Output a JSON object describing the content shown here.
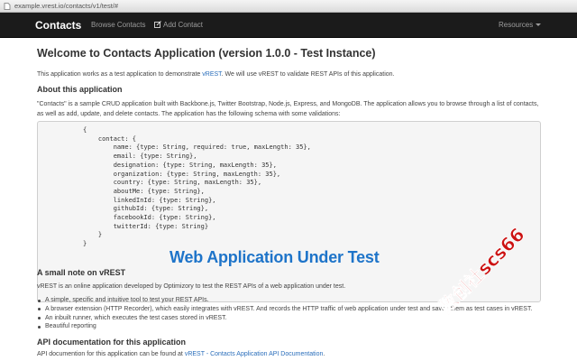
{
  "browser": {
    "url": "example.vrest.io/contacts/v1/test/#",
    "favicon_icon": "page-icon"
  },
  "navbar": {
    "brand": "Contacts",
    "browse": "Browse Contacts",
    "add": "Add Contact",
    "add_icon": "edit-plus-icon",
    "resources": "Resources"
  },
  "main": {
    "title": "Welcome to Contacts Application (version 1.0.0 - Test Instance)",
    "intro_before": "This application works as a test application to demonstrate ",
    "intro_link": "vREST",
    "intro_after": ". We will use vREST to validate REST APIs of this application.",
    "about_heading": "About this application",
    "about_text": "\"Contacts\" is a sample CRUD application built with Backbone.js, Twitter Bootstrap, Node.js, Express, and MongoDB. The application allows you to browse through a list of contacts, as well as add, update, and delete contacts. The application has the following schema with some validations:",
    "schema_code": "{\n    contact: {\n        name: {type: String, required: true, maxLength: 35},\n        email: {type: String},\n        designation: {type: String, maxLength: 35},\n        organization: {type: String, maxLength: 35},\n        country: {type: String, maxLength: 35},\n        aboutMe: {type: String},\n        linkedInId: {type: String},\n        githubId: {type: String},\n        facebookId: {type: String},\n        twitterId: {type: String}\n    }\n}",
    "overlay_caption": "Web Application Under Test",
    "note_heading": "A small note on vREST",
    "note_text": "vREST is an online application developed by Optimizory to test the REST APIs of a web application under test.",
    "bullets": [
      "A simple, specific and intuitive tool to test your REST APIs.",
      "A browser extension (HTTP Recorder), which easily integrates with vREST. And records the HTTP traffic of web application under test and saves them as test cases in vREST.",
      "An inbuilt runner, which executes the test cases stored in vREST.",
      "Beautiful reporting"
    ],
    "api_heading": "API documentation for this application",
    "api_before": "API documention for this application can be found at ",
    "api_link": "vREST - Contacts Application API Documentation",
    "api_after": "."
  },
  "watermark": {
    "text": "数创社scs66",
    "color": "#cc1111"
  }
}
